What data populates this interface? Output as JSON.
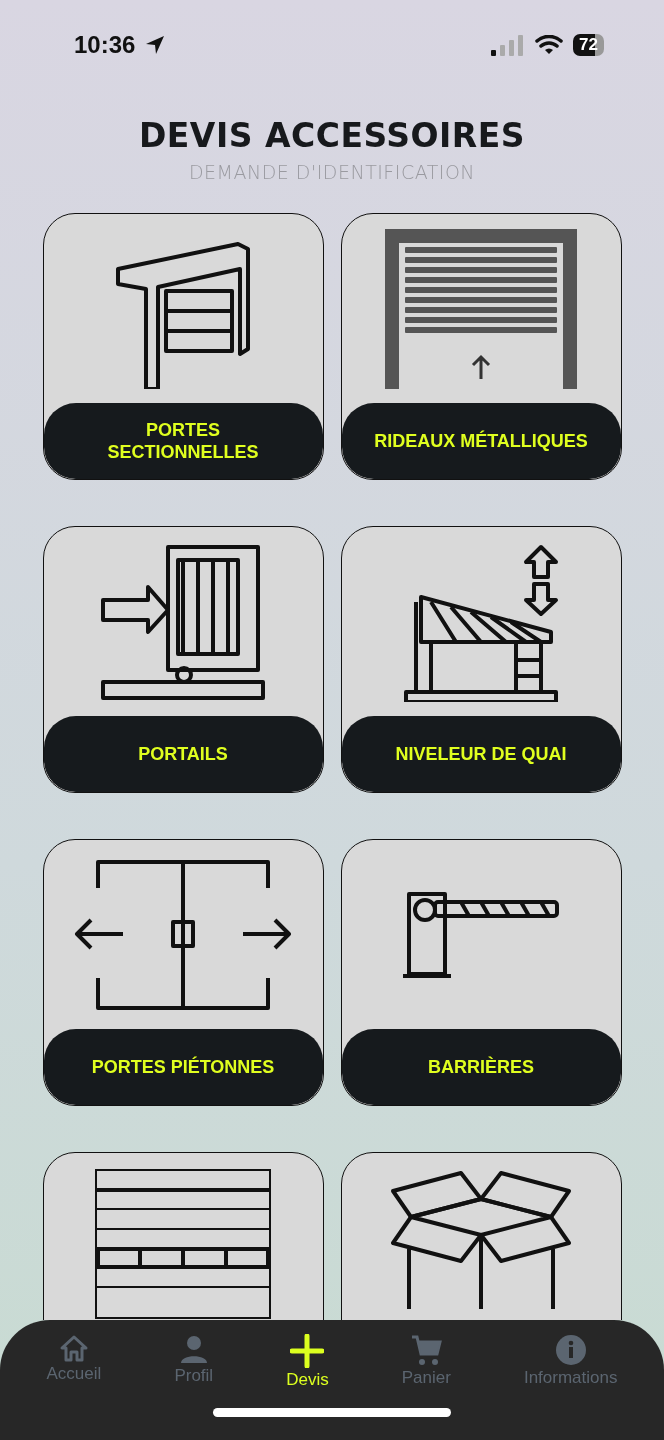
{
  "status_bar": {
    "time": "10:36",
    "battery": "72"
  },
  "header": {
    "title": "DEVIS ACCESSOIRES",
    "subtitle": "DEMANDE D'IDENTIFICATION"
  },
  "categories": [
    {
      "kind": "sectional",
      "label": "PORTES\nSECTIONNELLES"
    },
    {
      "kind": "shutter",
      "label": "RIDEAUX MÉTALLIQUES"
    },
    {
      "kind": "gate",
      "label": "PORTAILS"
    },
    {
      "kind": "leveler",
      "label": "NIVELEUR DE QUAI"
    },
    {
      "kind": "pedestrian",
      "label": "PORTES PIÉTONNES"
    },
    {
      "kind": "barrier",
      "label": "BARRIÈRES"
    },
    {
      "kind": "panel"
    },
    {
      "kind": "box"
    }
  ],
  "tab_bar": [
    {
      "kind": "home",
      "label": "Accueil",
      "selected": false
    },
    {
      "kind": "person",
      "label": "Profil",
      "selected": false
    },
    {
      "kind": "plus",
      "label": "Devis",
      "selected": true
    },
    {
      "kind": "cart",
      "label": "Panier",
      "selected": false
    },
    {
      "kind": "info",
      "label": "Informations",
      "selected": false
    }
  ]
}
